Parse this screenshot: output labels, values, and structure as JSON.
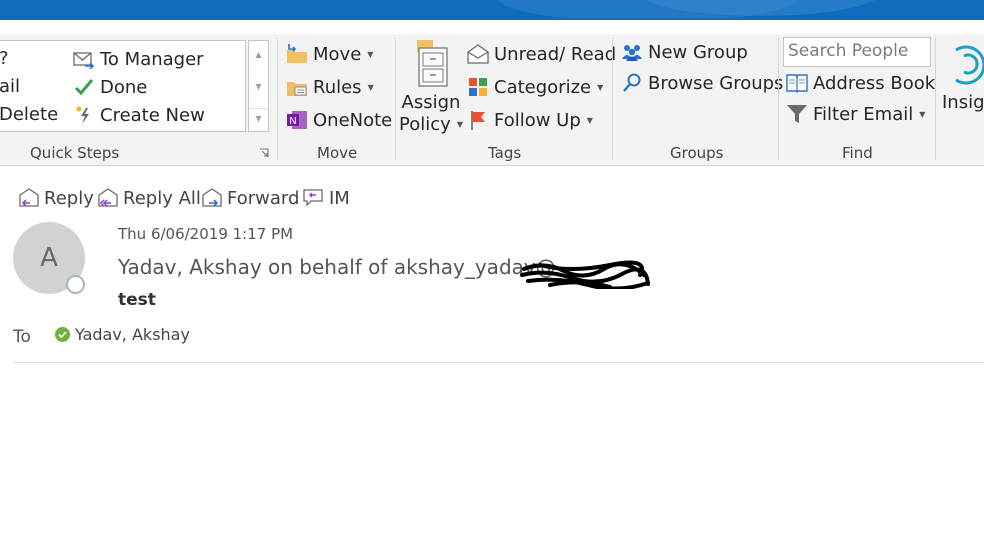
{
  "colors": {
    "accent": "#0f6cbd",
    "ribbon_bg": "#f3f3f3",
    "presence_available": "#6bb33c",
    "flag": "#e8512e"
  },
  "ribbon": {
    "quick_steps": {
      "label": "Quick Steps",
      "left_column": [
        "?",
        "ail",
        "Delete"
      ],
      "items": [
        {
          "label": "To Manager",
          "icon": "envelope-arrow-icon"
        },
        {
          "label": "Done",
          "icon": "checkmark-icon"
        },
        {
          "label": "Create New",
          "icon": "lightning-icon"
        }
      ]
    },
    "move": {
      "label": "Move",
      "items": [
        {
          "label": "Move",
          "icon": "move-folder-icon"
        },
        {
          "label": "Rules",
          "icon": "rules-icon"
        },
        {
          "label": "OneNote",
          "icon": "onenote-icon"
        }
      ]
    },
    "tags": {
      "label": "Tags",
      "assign_policy": {
        "line1": "Assign",
        "line2": "Policy",
        "icon": "cabinet-icon"
      },
      "items": [
        {
          "label": "Unread/ Read",
          "icon": "envelope-icon"
        },
        {
          "label": "Categorize",
          "icon": "categorize-icon"
        },
        {
          "label": "Follow Up",
          "icon": "flag-icon"
        }
      ]
    },
    "groups": {
      "label": "Groups",
      "items": [
        {
          "label": "New Group",
          "icon": "people-icon"
        },
        {
          "label": "Browse Groups",
          "icon": "magnifier-icon"
        }
      ]
    },
    "find": {
      "label": "Find",
      "search_placeholder": "Search People",
      "items": [
        {
          "label": "Address Book",
          "icon": "address-book-icon"
        },
        {
          "label": "Filter Email",
          "icon": "filter-icon"
        }
      ]
    },
    "insights": {
      "label": "Insigh"
    }
  },
  "message": {
    "actions": [
      {
        "label": "Reply",
        "icon": "reply-icon"
      },
      {
        "label": "Reply All",
        "icon": "reply-all-icon"
      },
      {
        "label": "Forward",
        "icon": "forward-icon"
      },
      {
        "label": "IM",
        "icon": "im-icon"
      }
    ],
    "avatar_initial": "A",
    "date": "Thu 6/06/2019 1:17 PM",
    "from": "Yadav, Akshay on behalf of akshay_yadav@",
    "subject": "test",
    "to_label": "To",
    "to_name": "Yadav, Akshay"
  }
}
